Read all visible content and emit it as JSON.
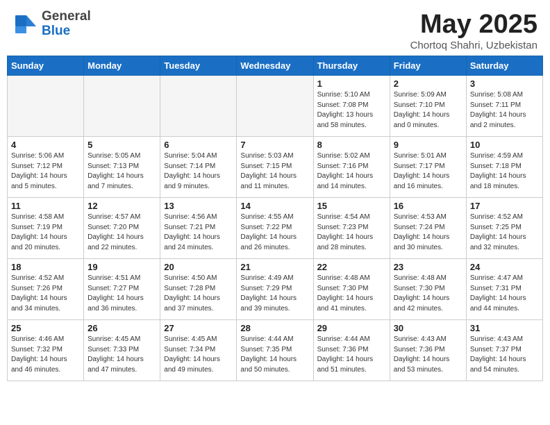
{
  "header": {
    "logo": {
      "general": "General",
      "blue": "Blue",
      "arrow_icon": "▶"
    },
    "title": "May 2025",
    "subtitle": "Chortoq Shahri, Uzbekistan"
  },
  "calendar": {
    "weekdays": [
      "Sunday",
      "Monday",
      "Tuesday",
      "Wednesday",
      "Thursday",
      "Friday",
      "Saturday"
    ],
    "weeks": [
      [
        {
          "day": "",
          "info": ""
        },
        {
          "day": "",
          "info": ""
        },
        {
          "day": "",
          "info": ""
        },
        {
          "day": "",
          "info": ""
        },
        {
          "day": "1",
          "info": "Sunrise: 5:10 AM\nSunset: 7:08 PM\nDaylight: 13 hours\nand 58 minutes."
        },
        {
          "day": "2",
          "info": "Sunrise: 5:09 AM\nSunset: 7:10 PM\nDaylight: 14 hours\nand 0 minutes."
        },
        {
          "day": "3",
          "info": "Sunrise: 5:08 AM\nSunset: 7:11 PM\nDaylight: 14 hours\nand 2 minutes."
        }
      ],
      [
        {
          "day": "4",
          "info": "Sunrise: 5:06 AM\nSunset: 7:12 PM\nDaylight: 14 hours\nand 5 minutes."
        },
        {
          "day": "5",
          "info": "Sunrise: 5:05 AM\nSunset: 7:13 PM\nDaylight: 14 hours\nand 7 minutes."
        },
        {
          "day": "6",
          "info": "Sunrise: 5:04 AM\nSunset: 7:14 PM\nDaylight: 14 hours\nand 9 minutes."
        },
        {
          "day": "7",
          "info": "Sunrise: 5:03 AM\nSunset: 7:15 PM\nDaylight: 14 hours\nand 11 minutes."
        },
        {
          "day": "8",
          "info": "Sunrise: 5:02 AM\nSunset: 7:16 PM\nDaylight: 14 hours\nand 14 minutes."
        },
        {
          "day": "9",
          "info": "Sunrise: 5:01 AM\nSunset: 7:17 PM\nDaylight: 14 hours\nand 16 minutes."
        },
        {
          "day": "10",
          "info": "Sunrise: 4:59 AM\nSunset: 7:18 PM\nDaylight: 14 hours\nand 18 minutes."
        }
      ],
      [
        {
          "day": "11",
          "info": "Sunrise: 4:58 AM\nSunset: 7:19 PM\nDaylight: 14 hours\nand 20 minutes."
        },
        {
          "day": "12",
          "info": "Sunrise: 4:57 AM\nSunset: 7:20 PM\nDaylight: 14 hours\nand 22 minutes."
        },
        {
          "day": "13",
          "info": "Sunrise: 4:56 AM\nSunset: 7:21 PM\nDaylight: 14 hours\nand 24 minutes."
        },
        {
          "day": "14",
          "info": "Sunrise: 4:55 AM\nSunset: 7:22 PM\nDaylight: 14 hours\nand 26 minutes."
        },
        {
          "day": "15",
          "info": "Sunrise: 4:54 AM\nSunset: 7:23 PM\nDaylight: 14 hours\nand 28 minutes."
        },
        {
          "day": "16",
          "info": "Sunrise: 4:53 AM\nSunset: 7:24 PM\nDaylight: 14 hours\nand 30 minutes."
        },
        {
          "day": "17",
          "info": "Sunrise: 4:52 AM\nSunset: 7:25 PM\nDaylight: 14 hours\nand 32 minutes."
        }
      ],
      [
        {
          "day": "18",
          "info": "Sunrise: 4:52 AM\nSunset: 7:26 PM\nDaylight: 14 hours\nand 34 minutes."
        },
        {
          "day": "19",
          "info": "Sunrise: 4:51 AM\nSunset: 7:27 PM\nDaylight: 14 hours\nand 36 minutes."
        },
        {
          "day": "20",
          "info": "Sunrise: 4:50 AM\nSunset: 7:28 PM\nDaylight: 14 hours\nand 37 minutes."
        },
        {
          "day": "21",
          "info": "Sunrise: 4:49 AM\nSunset: 7:29 PM\nDaylight: 14 hours\nand 39 minutes."
        },
        {
          "day": "22",
          "info": "Sunrise: 4:48 AM\nSunset: 7:30 PM\nDaylight: 14 hours\nand 41 minutes."
        },
        {
          "day": "23",
          "info": "Sunrise: 4:48 AM\nSunset: 7:30 PM\nDaylight: 14 hours\nand 42 minutes."
        },
        {
          "day": "24",
          "info": "Sunrise: 4:47 AM\nSunset: 7:31 PM\nDaylight: 14 hours\nand 44 minutes."
        }
      ],
      [
        {
          "day": "25",
          "info": "Sunrise: 4:46 AM\nSunset: 7:32 PM\nDaylight: 14 hours\nand 46 minutes."
        },
        {
          "day": "26",
          "info": "Sunrise: 4:45 AM\nSunset: 7:33 PM\nDaylight: 14 hours\nand 47 minutes."
        },
        {
          "day": "27",
          "info": "Sunrise: 4:45 AM\nSunset: 7:34 PM\nDaylight: 14 hours\nand 49 minutes."
        },
        {
          "day": "28",
          "info": "Sunrise: 4:44 AM\nSunset: 7:35 PM\nDaylight: 14 hours\nand 50 minutes."
        },
        {
          "day": "29",
          "info": "Sunrise: 4:44 AM\nSunset: 7:36 PM\nDaylight: 14 hours\nand 51 minutes."
        },
        {
          "day": "30",
          "info": "Sunrise: 4:43 AM\nSunset: 7:36 PM\nDaylight: 14 hours\nand 53 minutes."
        },
        {
          "day": "31",
          "info": "Sunrise: 4:43 AM\nSunset: 7:37 PM\nDaylight: 14 hours\nand 54 minutes."
        }
      ]
    ]
  }
}
